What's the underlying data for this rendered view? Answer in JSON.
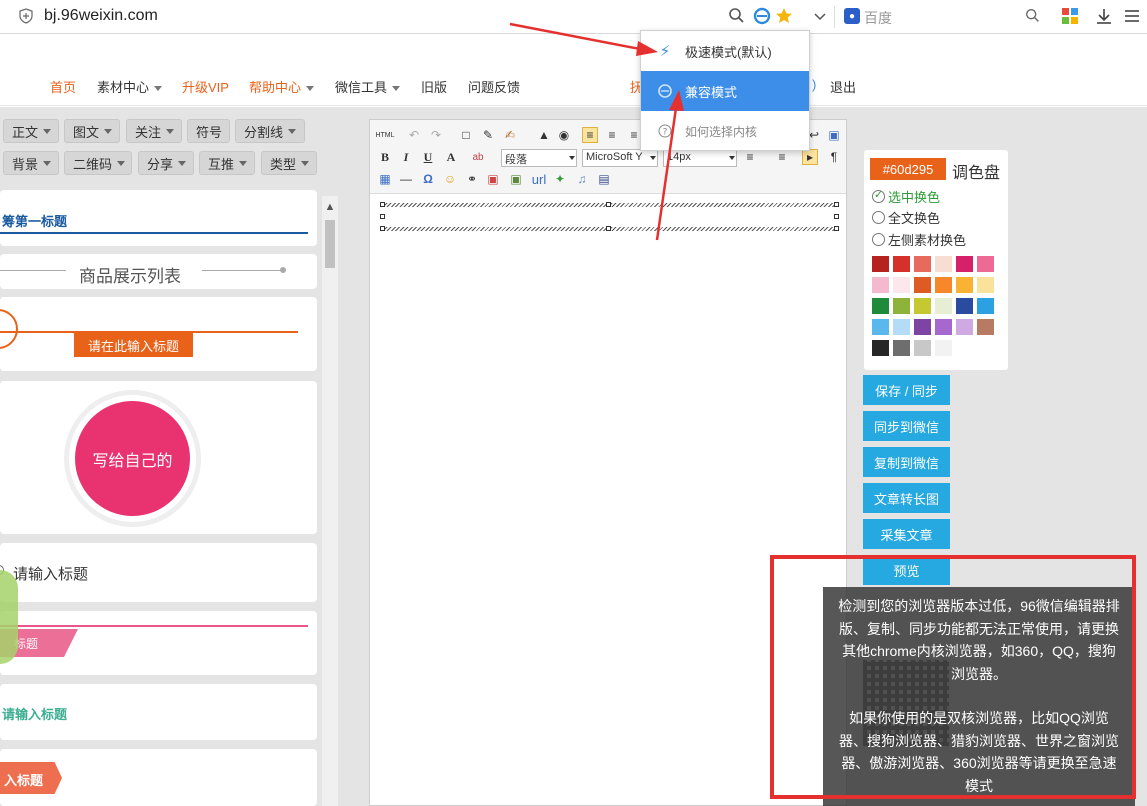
{
  "browser": {
    "url": "bj.96weixin.com",
    "search_placeholder": "百度"
  },
  "mode_menu": {
    "items": [
      {
        "label": "极速模式(默认)"
      },
      {
        "label": "兼容模式"
      },
      {
        "label": "如何选择内核"
      }
    ]
  },
  "nav": {
    "items": [
      "首页",
      "素材中心",
      "升级VIP",
      "帮助中心",
      "微信工具",
      "旧版",
      "问题反馈"
    ],
    "logout": "退出",
    "partial_left": "抚",
    "partial_right": ")"
  },
  "categories": {
    "row1": [
      "正文",
      "图文",
      "关注",
      "符号",
      "分割线"
    ],
    "row2": [
      "背景",
      "二维码",
      "分享",
      "互推",
      "类型"
    ]
  },
  "cards": {
    "card1_title": "第一标题",
    "card1_prefix": "筹",
    "card2_title": "商品展示列表",
    "card3_tag": "请在此输入标题",
    "card4_circle": "写给自己的",
    "card5_title": "请输入标题",
    "card6_tag": "标题",
    "card7_title": "请输入标题",
    "card8_tag": "入标题"
  },
  "editor": {
    "paragraph_select": "段落",
    "font_select": "MicroSoft Y",
    "size_select": "14px",
    "url_label": "url",
    "html_label": "HTML"
  },
  "palette": {
    "hex": "#60d295",
    "title": "调色盘",
    "options": [
      "选中换色",
      "全文换色",
      "左侧素材换色"
    ],
    "colors": [
      "#b5221f",
      "#d6302a",
      "#e86a5d",
      "#f8ddd3",
      "#d6206a",
      "#ec6a93",
      "#f4b9cf",
      "#fbe7ec",
      "#de5b24",
      "#f7882a",
      "#f9b233",
      "#fbe29a",
      "#1f8a3a",
      "#8db33a",
      "#c4c932",
      "#e6efd3",
      "#2b4ba0",
      "#2ca1e2",
      "#5ab8ec",
      "#b5dcf6",
      "#7d44a3",
      "#a667cf",
      "#cfa9e1",
      "#b77a63",
      "#262626",
      "#6e6e6e",
      "#c8c8c8",
      "#f2f2f2",
      "#ffffff",
      "#ffffff"
    ]
  },
  "actions": [
    "保存 / 同步",
    "同步到微信",
    "复制到微信",
    "文章转长图",
    "采集文章",
    "预览"
  ],
  "warning": {
    "para1": "检测到您的浏览器版本过低，96微信编辑器排版、复制、同步功能都无法正常使用，请更换其他chrome内核浏览器，如360，QQ，搜狗浏览器。",
    "para2": "如果你使用的是双核浏览器，比如QQ浏览器、搜狗浏览器、猎豹浏览器、世界之窗浏览器、傲游浏览器、360浏览器等请更换至急速模式"
  },
  "accent_colors": {
    "orange": "#e8621a",
    "blue": "#26a8e0",
    "menu_active": "#3d8ee8",
    "red_annotation": "#e53030"
  }
}
